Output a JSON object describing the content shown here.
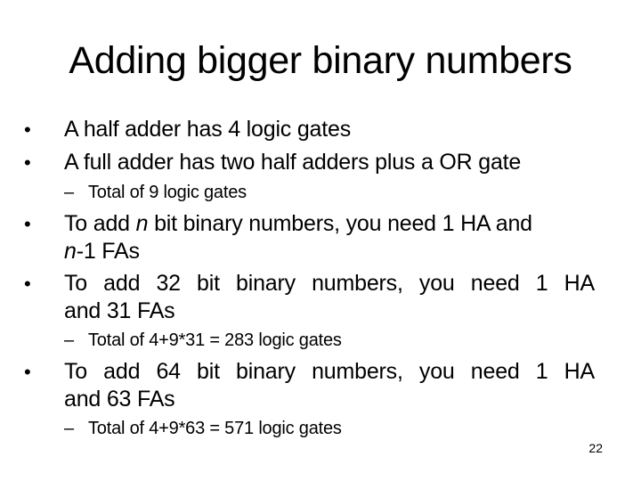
{
  "slide": {
    "title": "Adding bigger binary numbers",
    "slide_number": "22",
    "bullet_glyph": "•",
    "dash_glyph": "–",
    "items": [
      {
        "level": 1,
        "text": "A half adder has 4 logic gates"
      },
      {
        "level": 1,
        "text": "A full adder has two half adders plus a OR gate"
      },
      {
        "level": 2,
        "text": "Total of 9 logic gates"
      },
      {
        "level": 1,
        "parts": {
          "pre": "To add ",
          "var1": "n",
          "mid": " bit binary numbers, you need 1 HA and",
          "var2": "n",
          "post": "-1 FAs"
        }
      },
      {
        "level": 1,
        "line1": "To add 32 bit binary numbers, you need 1 HA",
        "line2": "and 31 FAs"
      },
      {
        "level": 2,
        "text": "Total of 4+9*31 = 283 logic gates"
      },
      {
        "level": 1,
        "line1": "To add 64 bit binary numbers, you need 1 HA",
        "line2": "and 63 FAs"
      },
      {
        "level": 2,
        "text": "Total of 4+9*63 = 571 logic gates"
      }
    ]
  }
}
